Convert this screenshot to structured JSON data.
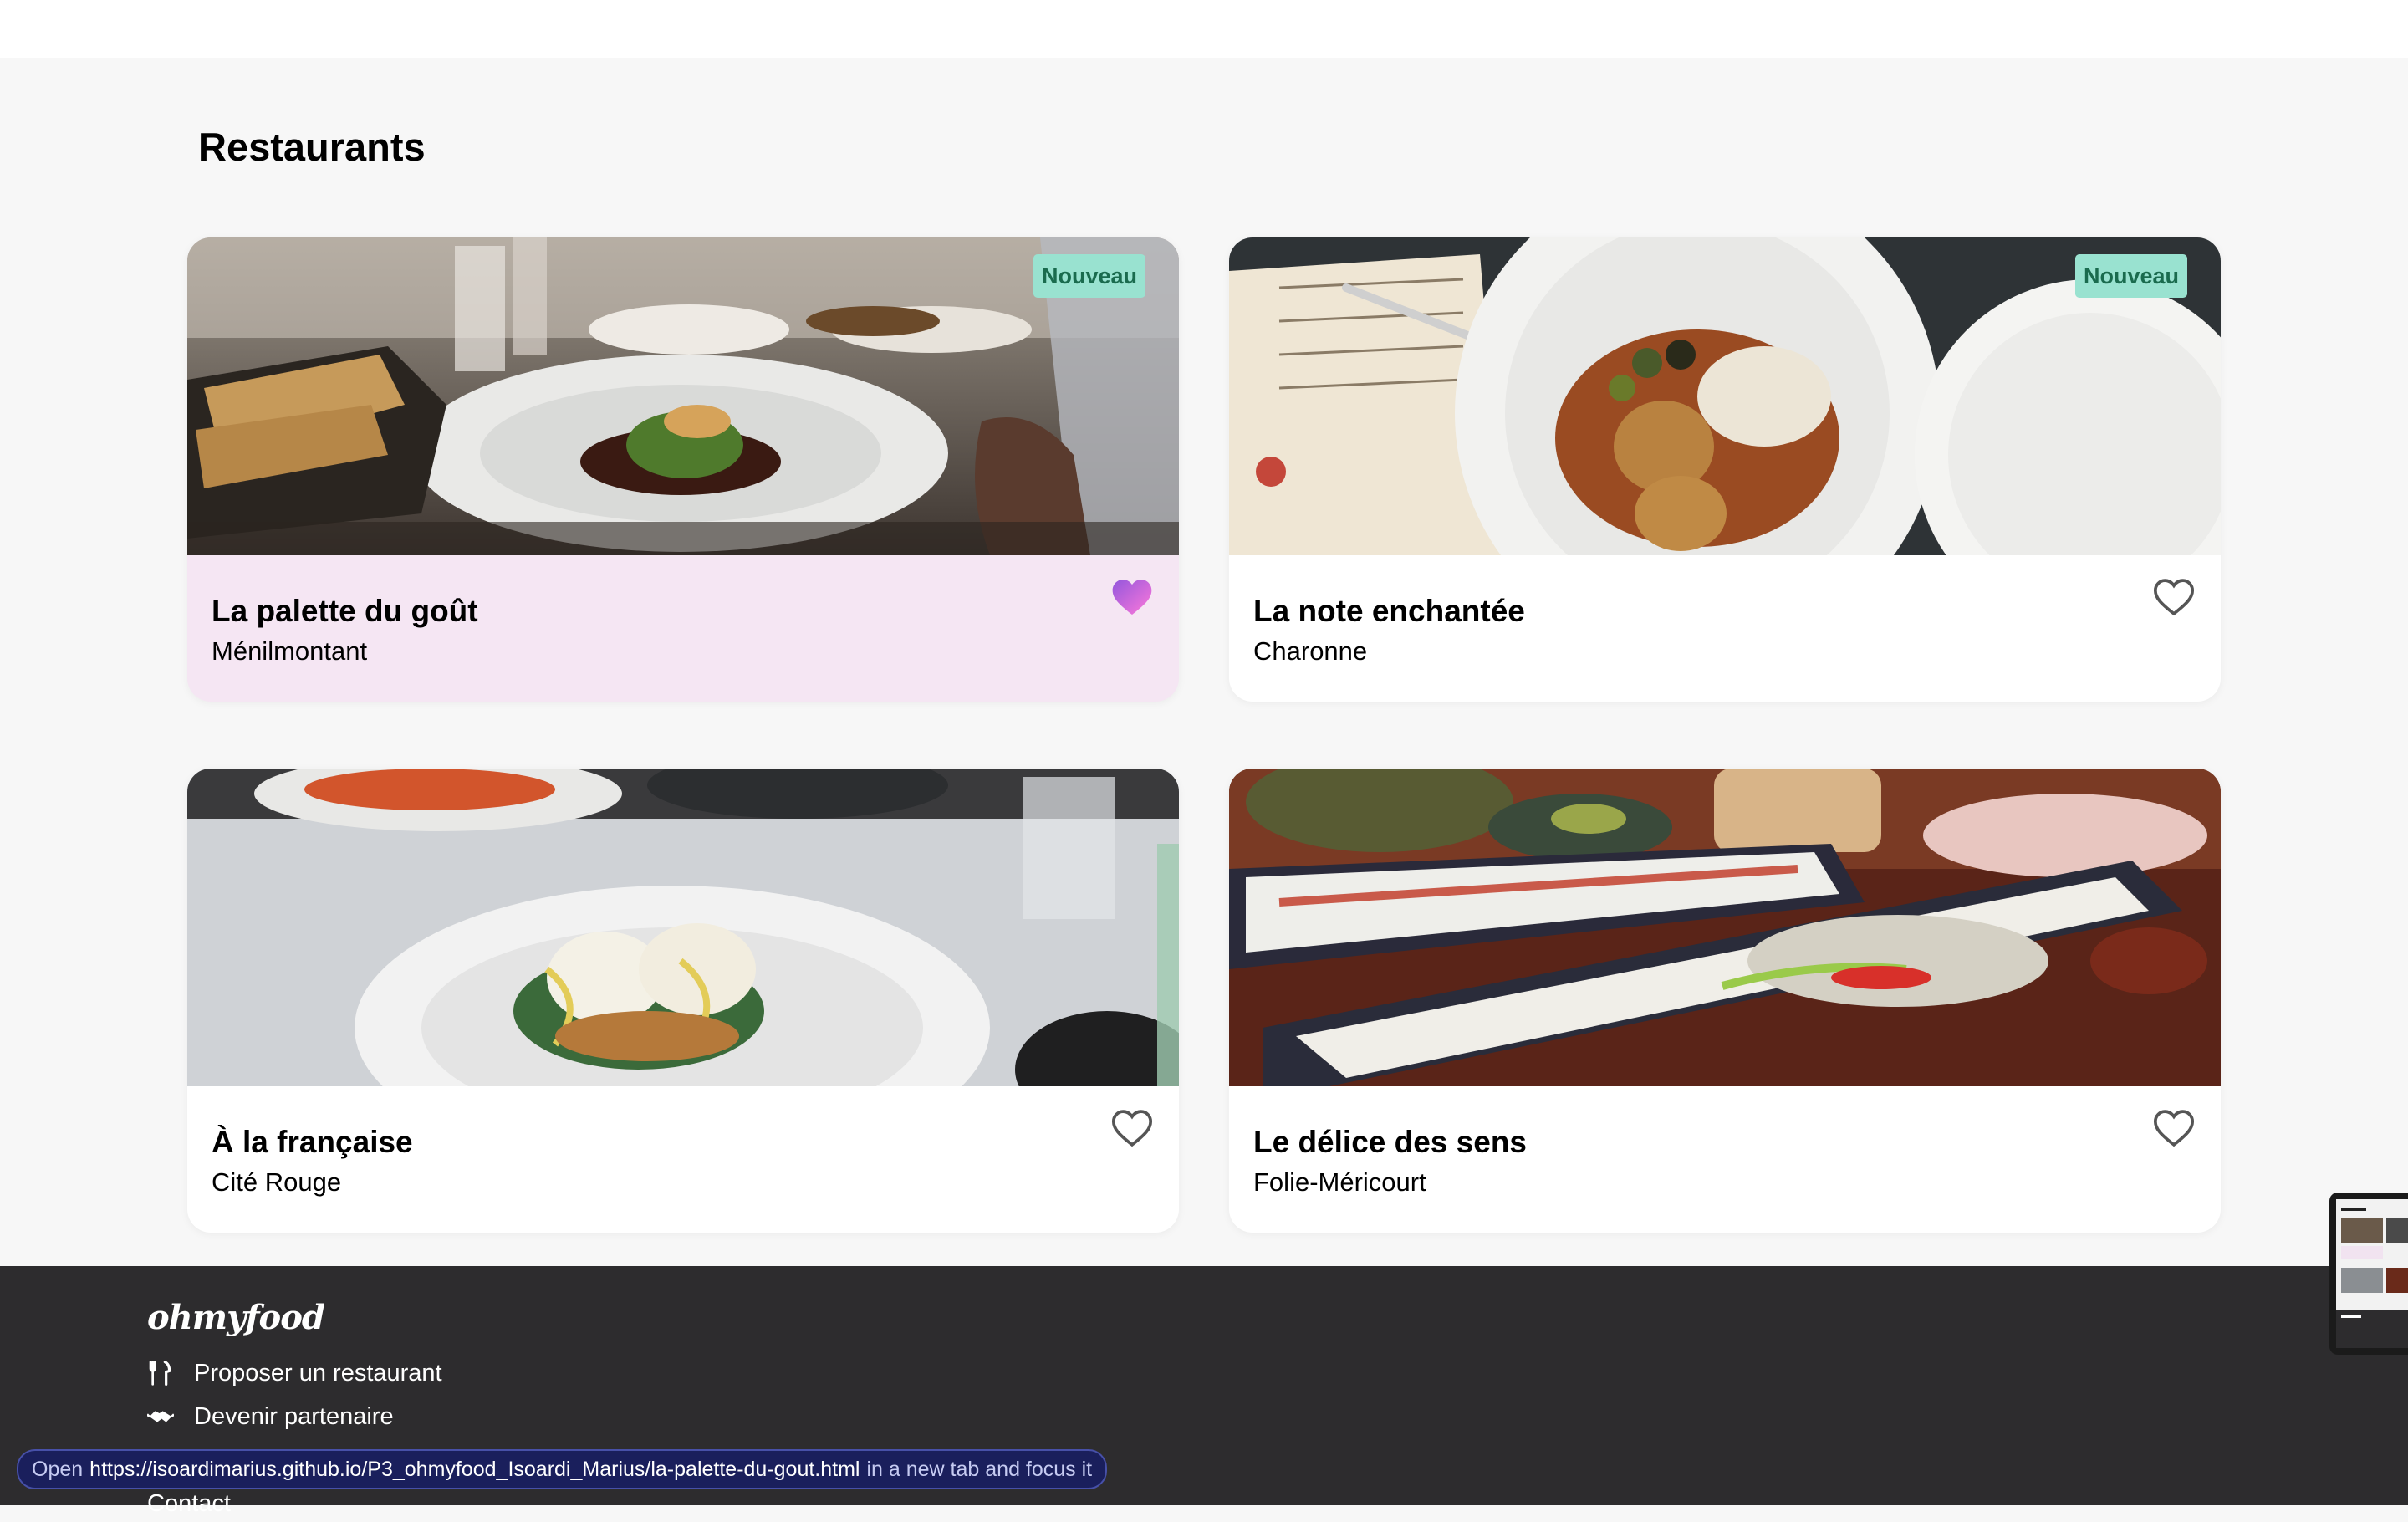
{
  "page": {
    "section_title": "Restaurants",
    "colors": {
      "page_background": "#f7f7f7",
      "card_active_background": "#f5e6f3",
      "heart_active": "#c86ad8",
      "badge_background": "#99e2d0",
      "badge_text": "#1a6b4e",
      "footer_background": "#2d2c2e"
    }
  },
  "restaurants": [
    {
      "name": "La palette du goût",
      "area": "Ménilmontant",
      "badge": "Nouveau",
      "liked": true
    },
    {
      "name": "La note enchantée",
      "area": "Charonne",
      "badge": "Nouveau",
      "liked": false
    },
    {
      "name": "À la française",
      "area": "Cité Rouge",
      "badge": "",
      "liked": false
    },
    {
      "name": "Le délice des sens",
      "area": "Folie-Méricourt",
      "badge": "",
      "liked": false
    }
  ],
  "footer": {
    "logo": "ohmyfood",
    "links": [
      {
        "label": "Proposer un restaurant",
        "icon": "utensils-icon"
      },
      {
        "label": "Devenir partenaire",
        "icon": "handshake-icon"
      },
      {
        "label": "Contact",
        "icon": ""
      }
    ]
  },
  "status_bar": {
    "prefix": "Open",
    "url": "https://isoardimarius.github.io/P3_ohmyfood_Isoardi_Marius/la-palette-du-gout.html",
    "suffix": "in a new tab and focus it"
  }
}
